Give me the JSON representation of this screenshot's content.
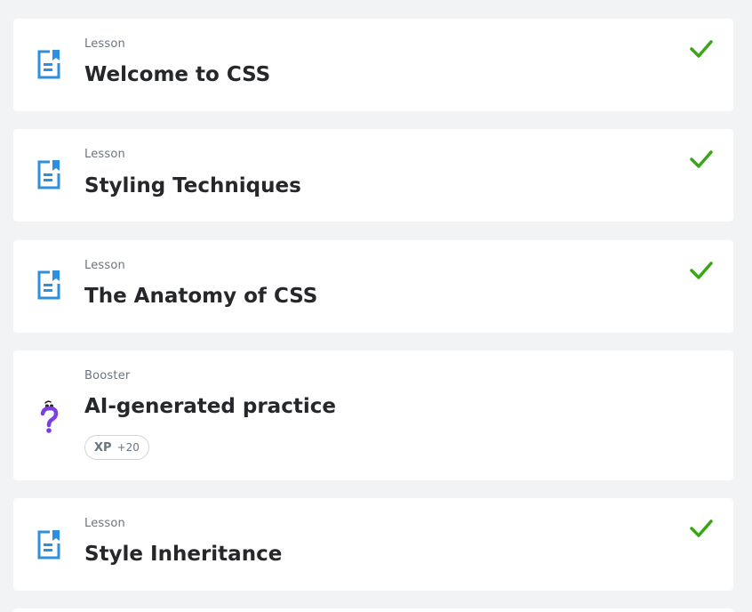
{
  "items": [
    {
      "type": "Lesson",
      "title": "Welcome to CSS",
      "icon": "lesson-doc-icon",
      "completed": true
    },
    {
      "type": "Lesson",
      "title": "Styling Techniques",
      "icon": "lesson-doc-icon",
      "completed": true
    },
    {
      "type": "Lesson",
      "title": "The Anatomy of CSS",
      "icon": "lesson-doc-icon",
      "completed": true
    },
    {
      "type": "Booster",
      "title": "AI-generated practice",
      "icon": "question-mark-icon",
      "completed": false,
      "xp_label": "XP",
      "xp_value": "+20"
    },
    {
      "type": "Lesson",
      "title": "Style Inheritance",
      "icon": "lesson-doc-icon",
      "completed": true
    }
  ],
  "colors": {
    "background": "#f1f3f5",
    "card": "#ffffff",
    "lesson_icon": "#2c8fe0",
    "check": "#3aa616",
    "booster_icon": "#7b3fe4",
    "title": "#25272b",
    "meta": "#6b7580"
  }
}
